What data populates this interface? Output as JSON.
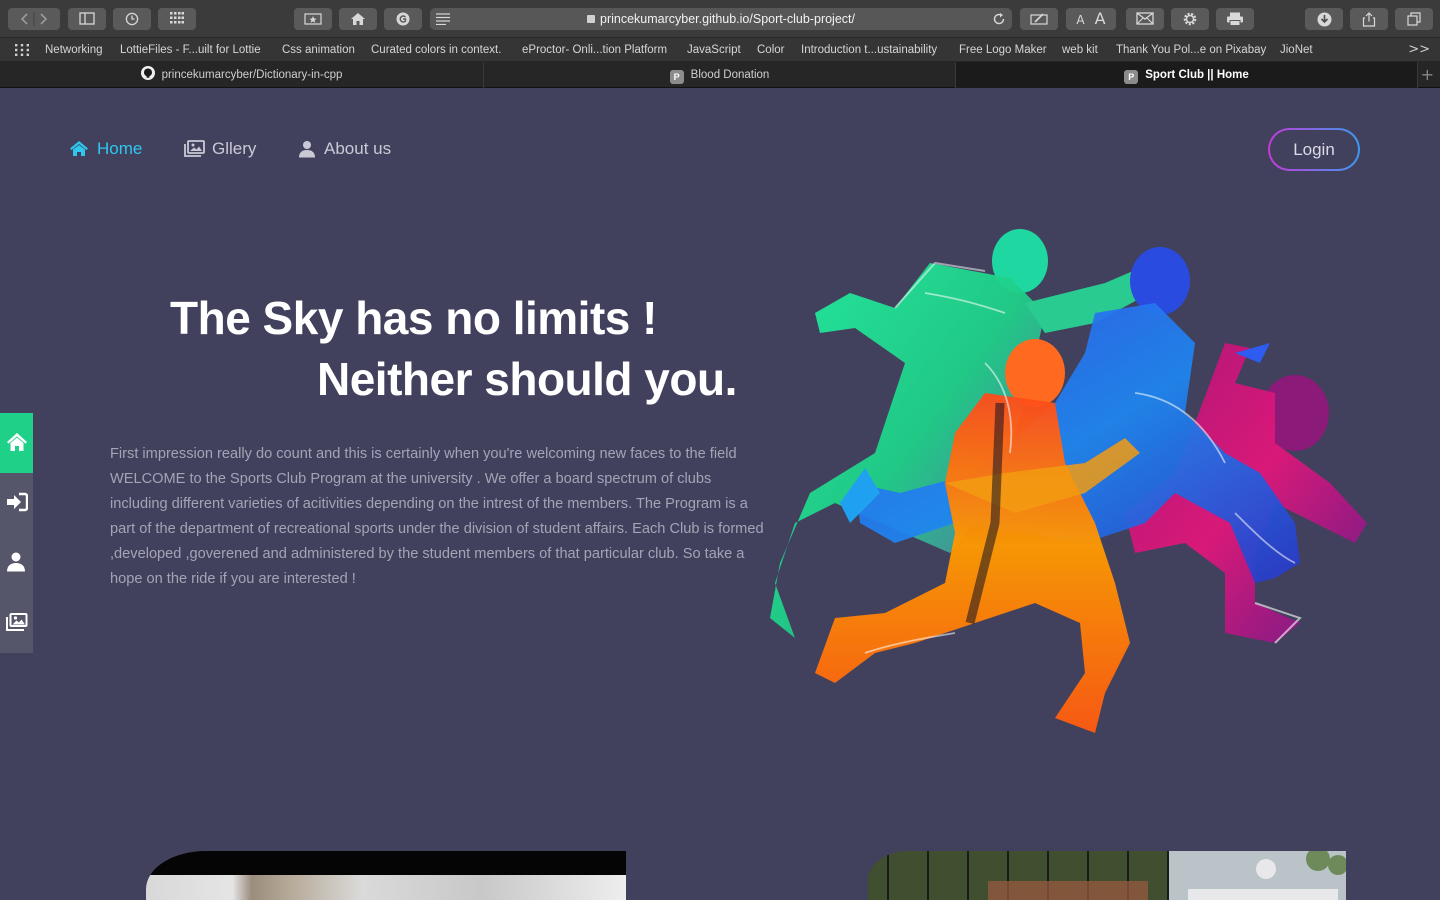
{
  "browser": {
    "url": "princekumarcyber.github.io/Sport-club-project/",
    "bookmarks": [
      "Networking",
      "LottieFiles - F...uilt for Lottie",
      "Css animation",
      "Curated colors in context.",
      "eProctor- Onli...tion Platform",
      "JavaScript",
      "Color",
      "Introduction t...ustainability",
      "Free Logo Maker",
      "web kit",
      "Thank You Pol...e on Pixabay",
      "JioNet"
    ],
    "tabs": [
      {
        "title": "princekumarcyber/Dictionary-in-cpp",
        "icon": "github-icon",
        "favicon_letter": ""
      },
      {
        "title": "Blood Donation",
        "icon": "p-favicon",
        "favicon_letter": "P"
      },
      {
        "title": "Sport Club || Home",
        "icon": "p-favicon",
        "favicon_letter": "P",
        "active": true
      }
    ],
    "text_size_small": "A",
    "text_size_large": "A",
    "more_bookmarks": ">>",
    "new_tab": "+"
  },
  "nav": {
    "home": "Home",
    "gallery": "Gllery",
    "about": "About us",
    "login": "Login",
    "active_color": "#2fc7ee"
  },
  "hero": {
    "headline_line1": "The Sky has no limits !",
    "headline_line2": "Neither should you.",
    "intro": "First impression really do count and this is certainly when you're welcoming new faces to the field WELCOME to the Sports Club Program at the university . We offer a board spectrum of clubs including different varieties of acitivities depending on the intrest of the members. The Program is a part of the department of recreational sports under the division of student affairs. Each Club is formed ,developed ,goverened and administered by the student members of that particular club. So take a hope on the ride if you are interested !"
  },
  "sidebar": {
    "items": [
      "home-icon",
      "sign-in-icon",
      "user-icon",
      "gallery-icon"
    ],
    "active_color": "#1fd089"
  },
  "colors": {
    "page_background": "#41415d",
    "login_border_start": "#c53ad6",
    "login_border_end": "#3a9af0"
  }
}
